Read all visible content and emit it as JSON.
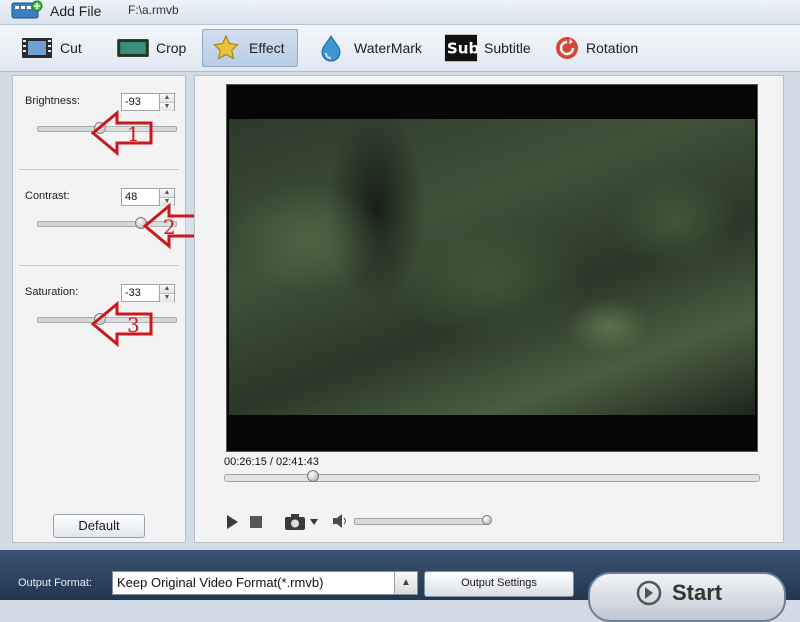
{
  "toolbar": {
    "add_file_label": "Add File",
    "file_path": "F:\\a.rmvb"
  },
  "tabs": [
    {
      "label": "Cut",
      "icon": "film-icon"
    },
    {
      "label": "Crop",
      "icon": "screen-icon"
    },
    {
      "label": "Effect",
      "icon": "star-icon",
      "active": true
    },
    {
      "label": "WaterMark",
      "icon": "water-drop-icon"
    },
    {
      "label": "Subtitle",
      "icon": "sub-icon",
      "icon_text": "Sub"
    },
    {
      "label": "Rotation",
      "icon": "rotation-icon"
    }
  ],
  "effects": {
    "brightness": {
      "label": "Brightness:",
      "value": "-93",
      "level": 0.44,
      "annotation": "1"
    },
    "contrast": {
      "label": "Contrast:",
      "value": "48",
      "level": 0.74,
      "annotation": "2"
    },
    "saturation": {
      "label": "Saturation:",
      "value": "-33",
      "level": 0.44,
      "annotation": "3"
    },
    "default_label": "Default"
  },
  "player": {
    "timecode": "00:26:15 / 02:41:43",
    "progress": 0.162,
    "volume": 0.98
  },
  "output": {
    "format_label": "Output Format:",
    "format_value": "Keep Original Video Format(*.rmvb)",
    "settings_label": "Output Settings",
    "start_label": "Start"
  },
  "colors": {
    "annotation_arrow": "#c8191f",
    "bottom_bar": "#2e4463",
    "active_tab": "#c5d6ec"
  }
}
